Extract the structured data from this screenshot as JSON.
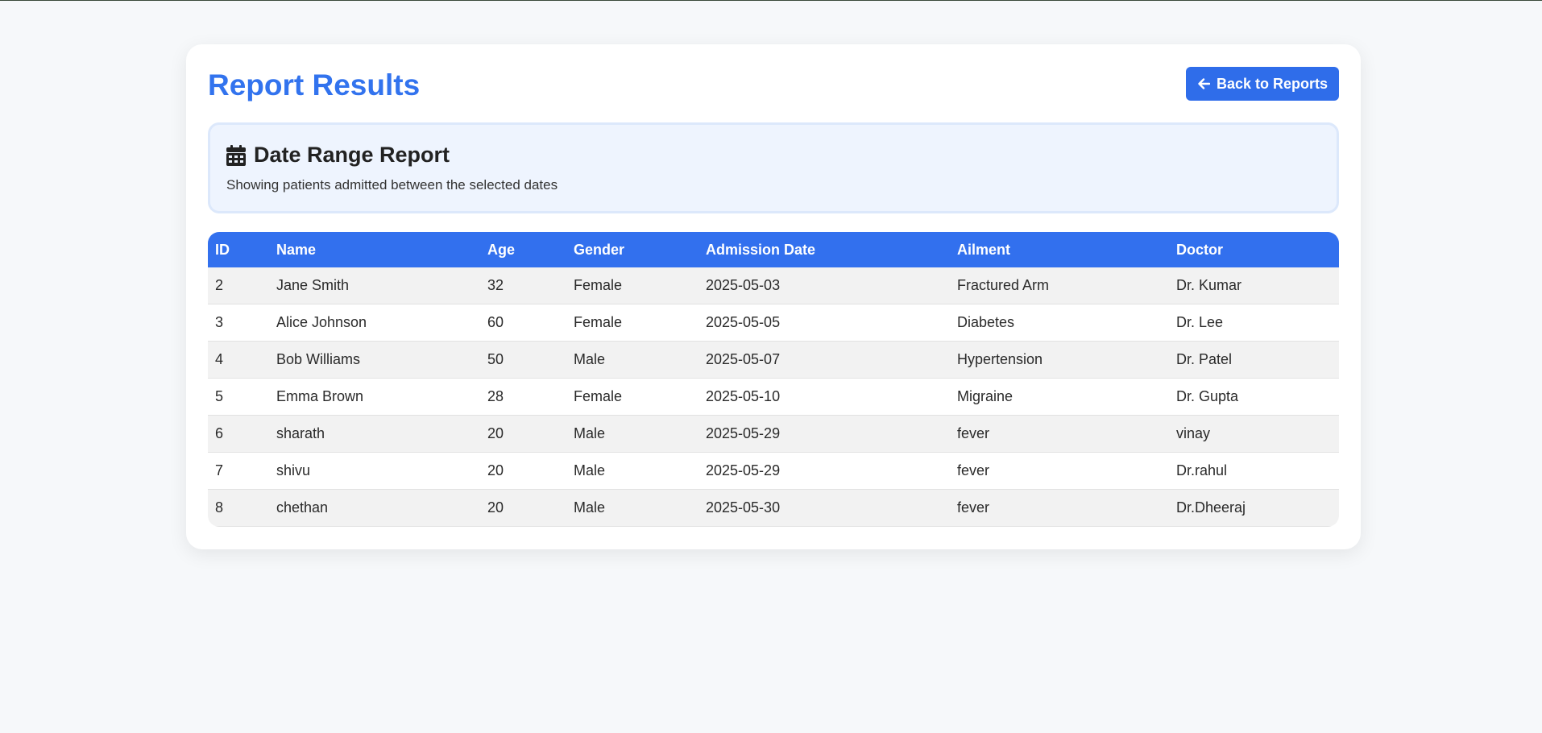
{
  "page": {
    "title": "Report Results",
    "back_label": "Back to Reports"
  },
  "report": {
    "title": "Date Range Report",
    "subtitle": "Showing patients admitted between the selected dates",
    "icon": "calendar-icon"
  },
  "table": {
    "headers": [
      "ID",
      "Name",
      "Age",
      "Gender",
      "Admission Date",
      "Ailment",
      "Doctor"
    ],
    "rows": [
      [
        "2",
        "Jane Smith",
        "32",
        "Female",
        "2025-05-03",
        "Fractured Arm",
        "Dr. Kumar"
      ],
      [
        "3",
        "Alice Johnson",
        "60",
        "Female",
        "2025-05-05",
        "Diabetes",
        "Dr. Lee"
      ],
      [
        "4",
        "Bob Williams",
        "50",
        "Male",
        "2025-05-07",
        "Hypertension",
        "Dr. Patel"
      ],
      [
        "5",
        "Emma Brown",
        "28",
        "Female",
        "2025-05-10",
        "Migraine",
        "Dr. Gupta"
      ],
      [
        "6",
        "sharath",
        "20",
        "Male",
        "2025-05-29",
        "fever",
        "vinay"
      ],
      [
        "7",
        "shivu",
        "20",
        "Male",
        "2025-05-29",
        "fever",
        "Dr.rahul"
      ],
      [
        "8",
        "chethan",
        "20",
        "Male",
        "2025-05-30",
        "fever",
        "Dr.Dheeraj"
      ]
    ]
  },
  "colors": {
    "accent": "#3273ee",
    "header_bg": "#3270ee",
    "page_bg": "#f6f8fa",
    "info_bg": "#eef4fe"
  }
}
